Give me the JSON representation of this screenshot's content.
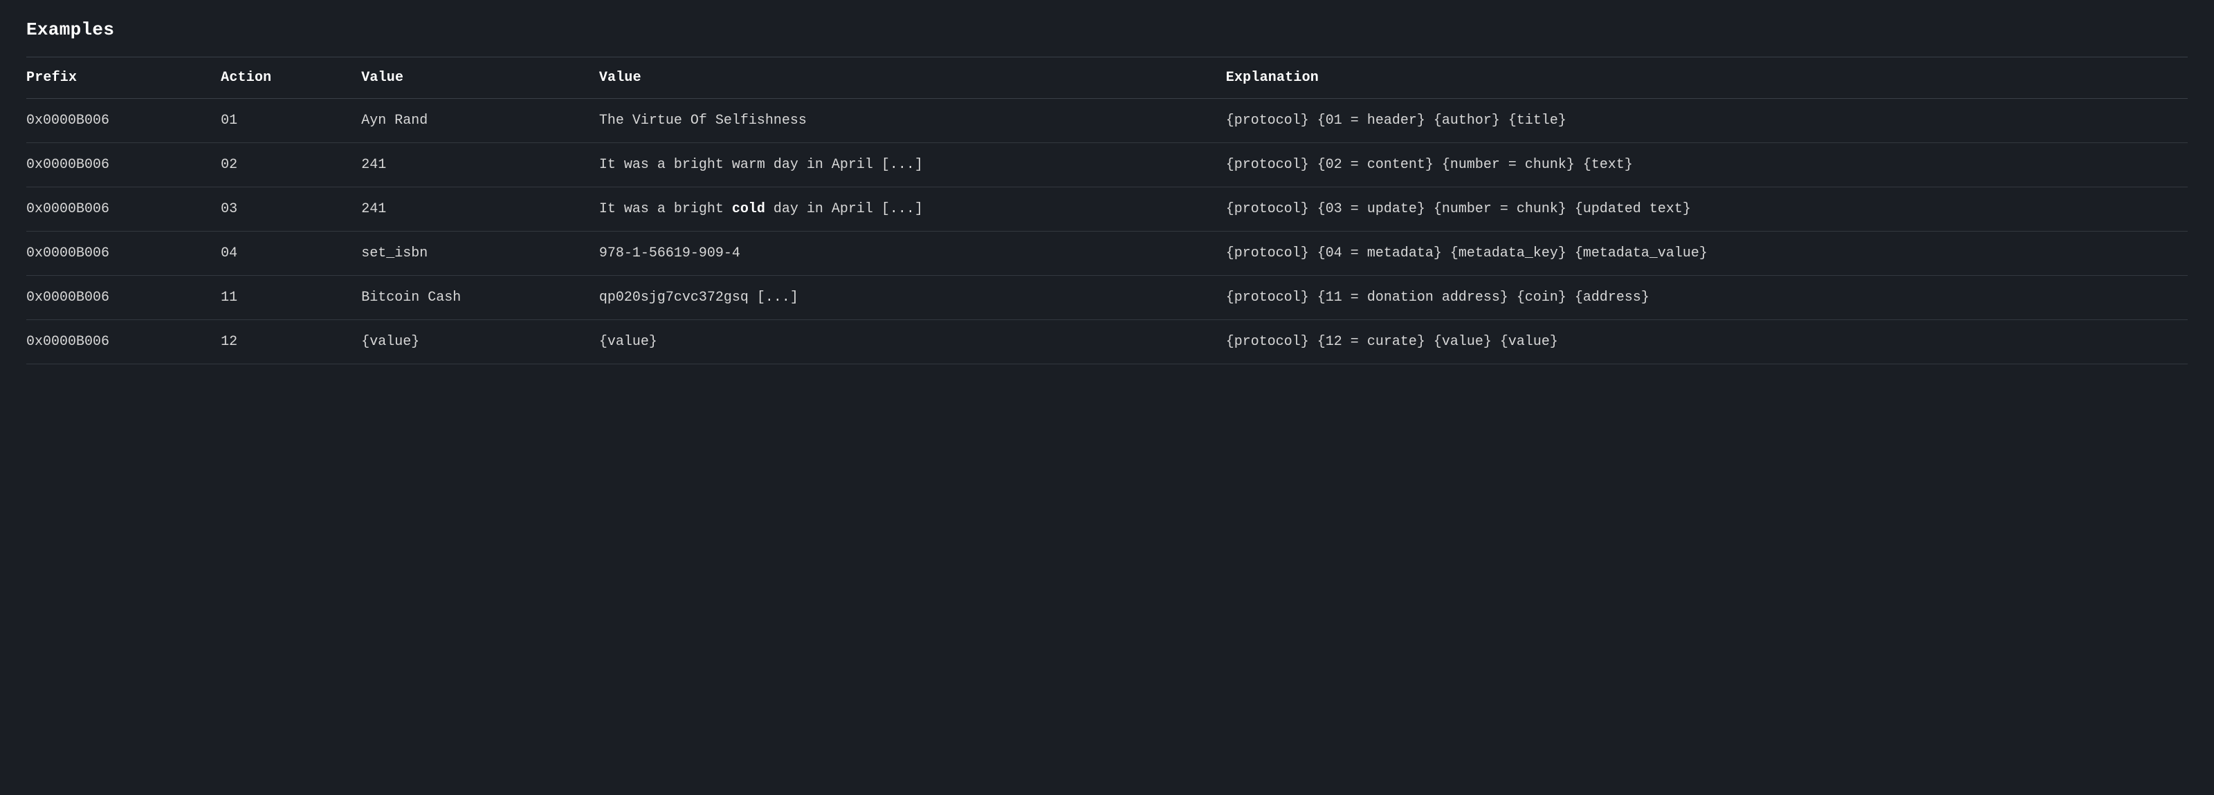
{
  "section_title": "Examples",
  "columns": {
    "prefix": "Prefix",
    "action": "Action",
    "value1": "Value",
    "value2": "Value",
    "explanation": "Explanation"
  },
  "rows": [
    {
      "prefix": "0x0000B006",
      "action": "01",
      "value1": "Ayn Rand",
      "value2": "The Virtue Of Selfishness",
      "explanation": "{protocol} {01 = header} {author} {title}"
    },
    {
      "prefix": "0x0000B006",
      "action": "02",
      "value1": "241",
      "value2": "It was a bright warm day in April [...]",
      "explanation": "{protocol} {02 = content} {number = chunk} {text}"
    },
    {
      "prefix": "0x0000B006",
      "action": "03",
      "value1": "241",
      "value2_html": "It was a bright <strong>cold</strong> day in April [...]",
      "explanation": "{protocol} {03 = update} {number = chunk} {updated text}"
    },
    {
      "prefix": "0x0000B006",
      "action": "04",
      "value1": "set_isbn",
      "value2": "978-1-56619-909-4",
      "explanation": "{protocol} {04 = metadata} {metadata_key} {metadata_value}"
    },
    {
      "prefix": "0x0000B006",
      "action": "11",
      "value1": "Bitcoin Cash",
      "value2": "qp020sjg7cvc372gsq [...]",
      "explanation": "{protocol} {11 = donation address} {coin} {address}"
    },
    {
      "prefix": "0x0000B006",
      "action": "12",
      "value1": "{value}",
      "value2": "{value}",
      "explanation": "{protocol} {12 = curate} {value} {value}"
    }
  ]
}
